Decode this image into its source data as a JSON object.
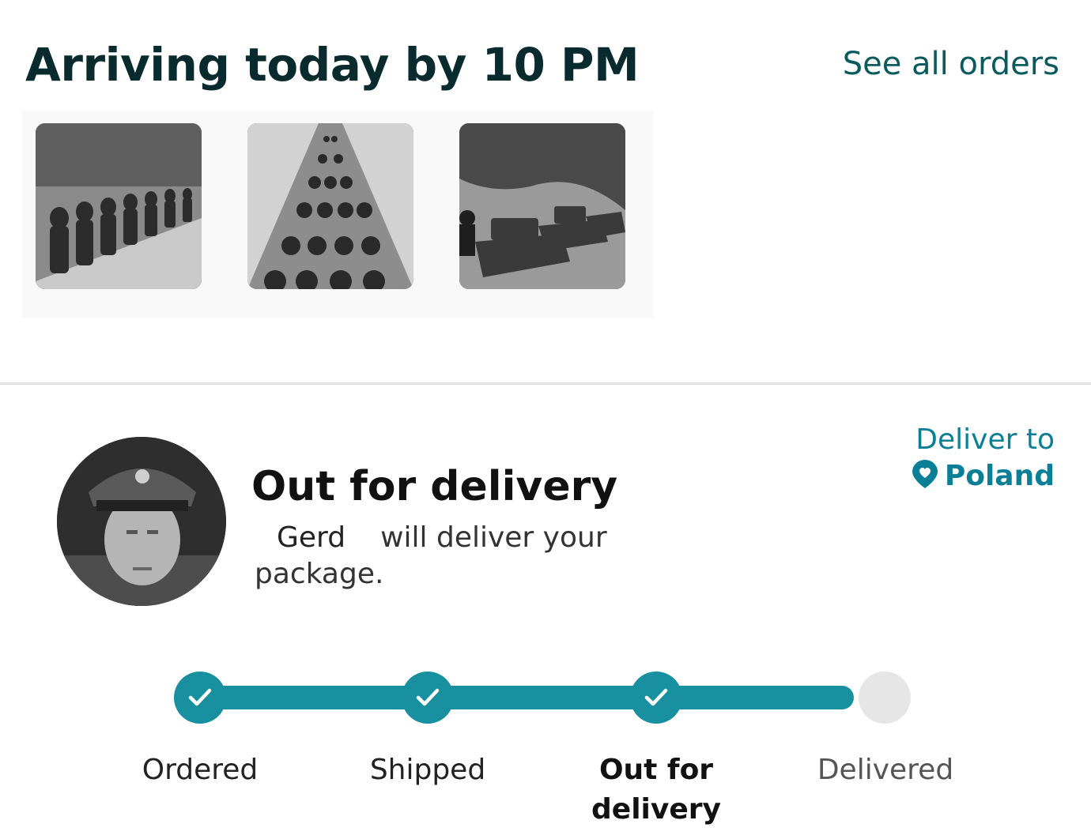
{
  "header": {
    "title": "Arriving today by 10 PM",
    "see_all_label": "See all orders"
  },
  "items": [
    {
      "name": "thumbnail-soldiers-marching"
    },
    {
      "name": "thumbnail-troop-column"
    },
    {
      "name": "thumbnail-tanks"
    }
  ],
  "delivery": {
    "status_title": "Out for delivery",
    "courier_name": "Gerd",
    "courier_message": "will deliver your package.",
    "deliver_to_label": "Deliver to",
    "deliver_to_location": "Poland",
    "location_icon": "map-pin-icon"
  },
  "tracker": {
    "steps": [
      {
        "label": "Ordered",
        "state": "done"
      },
      {
        "label": "Shipped",
        "state": "done"
      },
      {
        "label": "Out for delivery",
        "state": "current"
      },
      {
        "label": "Delivered",
        "state": "pending"
      }
    ],
    "progress_fraction": 0.75,
    "step_check_icon": "checkmark-icon"
  },
  "colors": {
    "accent": "#1890a0",
    "title": "#0a2b2e",
    "link": "#0b5b5e",
    "pending": "#e6e6e6"
  }
}
